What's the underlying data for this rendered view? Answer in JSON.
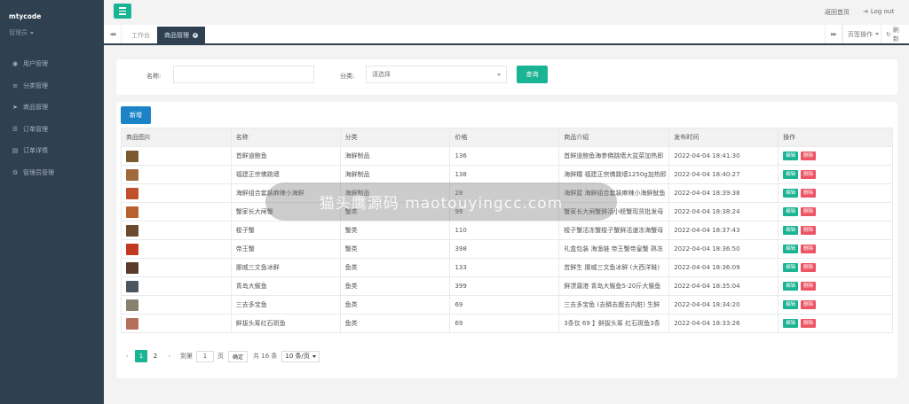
{
  "sidebar": {
    "brand": "mtycode",
    "role": "管理员",
    "items": [
      {
        "icon": "user-icon",
        "glyph": "◉",
        "label": "用户管理"
      },
      {
        "icon": "sliders-icon",
        "glyph": "≡",
        "label": "分类管理"
      },
      {
        "icon": "send-icon",
        "glyph": "➤",
        "label": "商品管理"
      },
      {
        "icon": "list-icon",
        "glyph": "☰",
        "label": "订单管理"
      },
      {
        "icon": "receipt-icon",
        "glyph": "▤",
        "label": "订单详情"
      },
      {
        "icon": "gear-icon",
        "glyph": "⚙",
        "label": "管理员管理"
      }
    ]
  },
  "topbar": {
    "home_label": "返回首页",
    "logout_label": "Log out"
  },
  "tabs": {
    "prev_glyph": "◀◀",
    "next_glyph": "▶▶",
    "items": [
      {
        "label": "工作台",
        "active": false
      },
      {
        "label": "商品管理",
        "active": true
      }
    ],
    "page_ops_label": "页签操作",
    "refresh_label": "刷新"
  },
  "search": {
    "name_label": "名称:",
    "name_value": "",
    "category_label": "分类:",
    "category_placeholder": "请选择",
    "query_label": "查询"
  },
  "table": {
    "add_label": "新增",
    "columns": [
      "商品图片",
      "名称",
      "分类",
      "价格",
      "商品介绍",
      "发布时间",
      "操作"
    ],
    "edit_label": "编辑",
    "delete_label": "删除",
    "rows": [
      {
        "name": "首鲜道鲍鱼",
        "category": "海鲜制品",
        "price": "136",
        "intro": "首鲜道鲍鱼海参佛跳墙大盆菜加热即",
        "time": "2022-04-04 18:41:30",
        "thumb_color": "#7a5a2e"
      },
      {
        "name": "福建正宗佛跳墙",
        "category": "海鲜制品",
        "price": "138",
        "intro": "海鲜糧 福建正宗佛跳墙1250g加热即",
        "time": "2022-04-04 18:40:27",
        "thumb_color": "#a06a3a"
      },
      {
        "name": "海鲜组合套装麻辣小海鲜",
        "category": "海鲜制品",
        "price": "28",
        "intro": "海鲜屋 海鲜组合套装麻辣小海鲜鱿鱼",
        "time": "2022-04-04 18:39:38",
        "thumb_color": "#c0502a"
      },
      {
        "name": "蟹家长大闸蟹",
        "category": "蟹类",
        "price": "99",
        "intro": "蟹家长大闸蟹鲜活小螃蟹现货批发母",
        "time": "2022-04-04 18:38:24",
        "thumb_color": "#b8602e"
      },
      {
        "name": "梭子蟹",
        "category": "蟹类",
        "price": "110",
        "intro": "梭子蟹活冻蟹梭子蟹鲜活速冻海蟹母",
        "time": "2022-04-04 18:37:43",
        "thumb_color": "#6b4a30"
      },
      {
        "name": "帝王蟹",
        "category": "蟹类",
        "price": "398",
        "intro": "礼盒包装 海渔链 帝王蟹帝皇蟹 熟冻",
        "time": "2022-04-04 18:36:50",
        "thumb_color": "#c2391f"
      },
      {
        "name": "挪威三文鱼冰鲜",
        "category": "鱼类",
        "price": "133",
        "intro": "苦鲜生 挪威三文鱼冰鲜 (大西洋鲑)",
        "time": "2022-04-04 18:36:09",
        "thumb_color": "#5a3a2a"
      },
      {
        "name": "青岛大鲅鱼",
        "category": "鱼类",
        "price": "399",
        "intro": "鲜漂漏港 青岛大鲅鱼5-20斤大鲅鱼",
        "time": "2022-04-04 18:35:04",
        "thumb_color": "#4a5560"
      },
      {
        "name": "三去多宝鱼",
        "category": "鱼类",
        "price": "69",
        "intro": "三去多宝鱼 (去鳞去腮去内脏) 生鲜",
        "time": "2022-04-04 18:34:20",
        "thumb_color": "#8a8070"
      },
      {
        "name": "鲜拔头筹红石斑鱼",
        "category": "鱼类",
        "price": "69",
        "intro": "3条仅 69 】鲜拔头筹 红石斑鱼3条",
        "time": "2022-04-04 18:33:26",
        "thumb_color": "#b5705a"
      }
    ]
  },
  "pager": {
    "prev_glyph": "‹",
    "pages": [
      "1",
      "2"
    ],
    "current": "1",
    "next_glyph": "›",
    "goto_label": "到第",
    "goto_value": "1",
    "page_unit": "页",
    "confirm_label": "确定",
    "total_label": "共 16 条",
    "size_label": "10 条/页"
  },
  "overlay_text": "猫头鹰源码 maotouyingcc.com"
}
